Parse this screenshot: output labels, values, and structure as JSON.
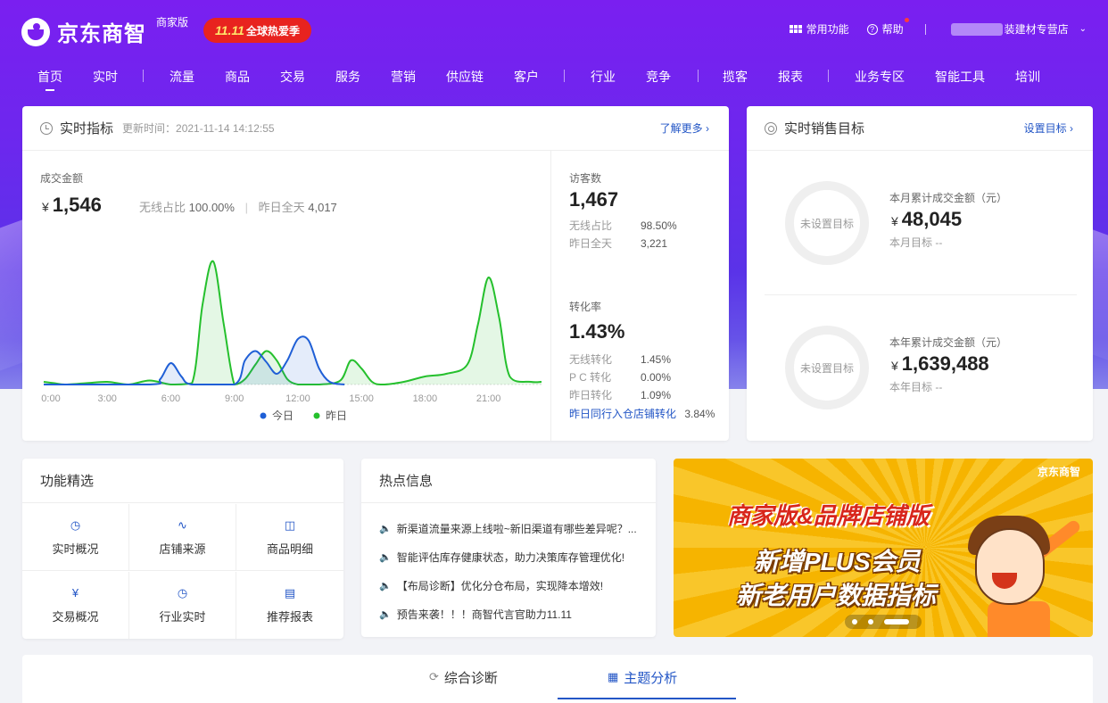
{
  "header": {
    "logo_text": "京东商智",
    "edition": "商家版",
    "promo_prefix": "11.11",
    "promo_text": "全球热爱季",
    "tools": {
      "common": "常用功能",
      "help": "帮助"
    },
    "store_name": "装建材专营店"
  },
  "nav": {
    "items": [
      "首页",
      "实时",
      "流量",
      "商品",
      "交易",
      "服务",
      "营销",
      "供应链",
      "客户",
      "行业",
      "竞争",
      "揽客",
      "报表",
      "业务专区",
      "智能工具",
      "培训"
    ],
    "active": "首页"
  },
  "realtime": {
    "title": "实时指标",
    "update_prefix": "更新时间：",
    "update_time": "2021-11-14 14:12:55",
    "more_link": "了解更多",
    "gmv_label": "成交金额",
    "currency": "¥",
    "gmv_value": "1,546",
    "mobile_ratio_label": "无线占比",
    "mobile_ratio_value": "100.00%",
    "yesterday_label": "昨日全天",
    "yesterday_value": "4,017",
    "legend_today": "今日",
    "legend_yesterday": "昨日",
    "visitors": {
      "label": "访客数",
      "value": "1,467",
      "rows": [
        {
          "k": "无线占比",
          "v": "98.50%"
        },
        {
          "k": "昨日全天",
          "v": "3,221"
        }
      ]
    },
    "conversion": {
      "label": "转化率",
      "value": "1.43%",
      "rows": [
        {
          "k": "无线转化",
          "v": "1.45%"
        },
        {
          "k": "P C 转化",
          "v": "0.00%"
        },
        {
          "k": "昨日转化",
          "v": "1.09%"
        }
      ],
      "peer_label": "昨日同行入仓店铺转化",
      "peer_value": "3.84%"
    }
  },
  "chart_data": {
    "type": "area",
    "x_ticks": [
      "0:00",
      "3:00",
      "6:00",
      "9:00",
      "12:00",
      "15:00",
      "18:00",
      "21:00"
    ],
    "x_range": [
      0,
      23.5
    ],
    "y_range": [
      0,
      1.0
    ],
    "series": [
      {
        "name": "今日",
        "color": "#1f5fd6",
        "x": [
          0,
          5,
          5.5,
          6,
          6.5,
          7,
          9,
          9.5,
          10,
          10.5,
          11,
          11.5,
          12,
          12.5,
          13,
          13.5,
          14.2
        ],
        "values": [
          0,
          0,
          0.04,
          0.16,
          0.06,
          0,
          0,
          0.18,
          0.25,
          0.17,
          0.08,
          0.18,
          0.34,
          0.33,
          0.12,
          0.02,
          0
        ]
      },
      {
        "name": "昨日",
        "color": "#25c02d",
        "x": [
          0,
          0.5,
          1,
          2,
          3,
          4,
          5,
          6,
          7,
          7.5,
          8,
          8.5,
          9,
          9.5,
          10,
          10.5,
          11,
          11.5,
          12,
          12.5,
          13,
          14,
          14.5,
          15,
          15.5,
          16,
          17,
          18,
          19,
          20,
          20.5,
          21,
          21.5,
          22,
          23,
          23.5
        ],
        "values": [
          0.02,
          0.01,
          0,
          0.01,
          0.02,
          0,
          0.03,
          0,
          0.01,
          0.6,
          0.92,
          0.45,
          0,
          0.04,
          0.15,
          0.25,
          0.18,
          0.04,
          0,
          0,
          0,
          0.03,
          0.18,
          0.12,
          0.02,
          0,
          0.02,
          0.06,
          0.08,
          0.15,
          0.45,
          0.8,
          0.5,
          0.06,
          0.02,
          0.02
        ]
      }
    ]
  },
  "sales_target": {
    "title": "实时销售目标",
    "link": "设置目标",
    "month": {
      "ring_text": "未设置目标",
      "label": "本月累计成交金额（元）",
      "value": "48,045",
      "target_label": "本月目标",
      "target_value": "--"
    },
    "year": {
      "ring_text": "未设置目标",
      "label": "本年累计成交金额（元）",
      "value": "1,639,488",
      "target_label": "本年目标",
      "target_value": "--"
    }
  },
  "functions": {
    "title": "功能精选",
    "items": [
      {
        "label": "实时概况",
        "icon": "clock-icon"
      },
      {
        "label": "店铺来源",
        "icon": "pulse-icon"
      },
      {
        "label": "商品明细",
        "icon": "bag-icon"
      },
      {
        "label": "交易概况",
        "icon": "yuan-icon"
      },
      {
        "label": "行业实时",
        "icon": "clock-icon"
      },
      {
        "label": "推荐报表",
        "icon": "report-icon"
      }
    ]
  },
  "hot_news": {
    "title": "热点信息",
    "items": [
      "新渠道流量来源上线啦~新旧渠道有哪些差异呢？...",
      "智能评估库存健康状态，助力决策库存管理优化!",
      "【布局诊断】优化分仓布局，实现降本增效!",
      "预告来袭！！！商智代言官助力11.11"
    ]
  },
  "banner": {
    "logo": "京东商智",
    "line1": "商家版&品牌店铺版",
    "line2": "新增PLUS会员",
    "line3": "新老用户数据指标"
  },
  "bottom_tabs": {
    "items": [
      "综合诊断",
      "主题分析"
    ],
    "active": "主题分析"
  }
}
